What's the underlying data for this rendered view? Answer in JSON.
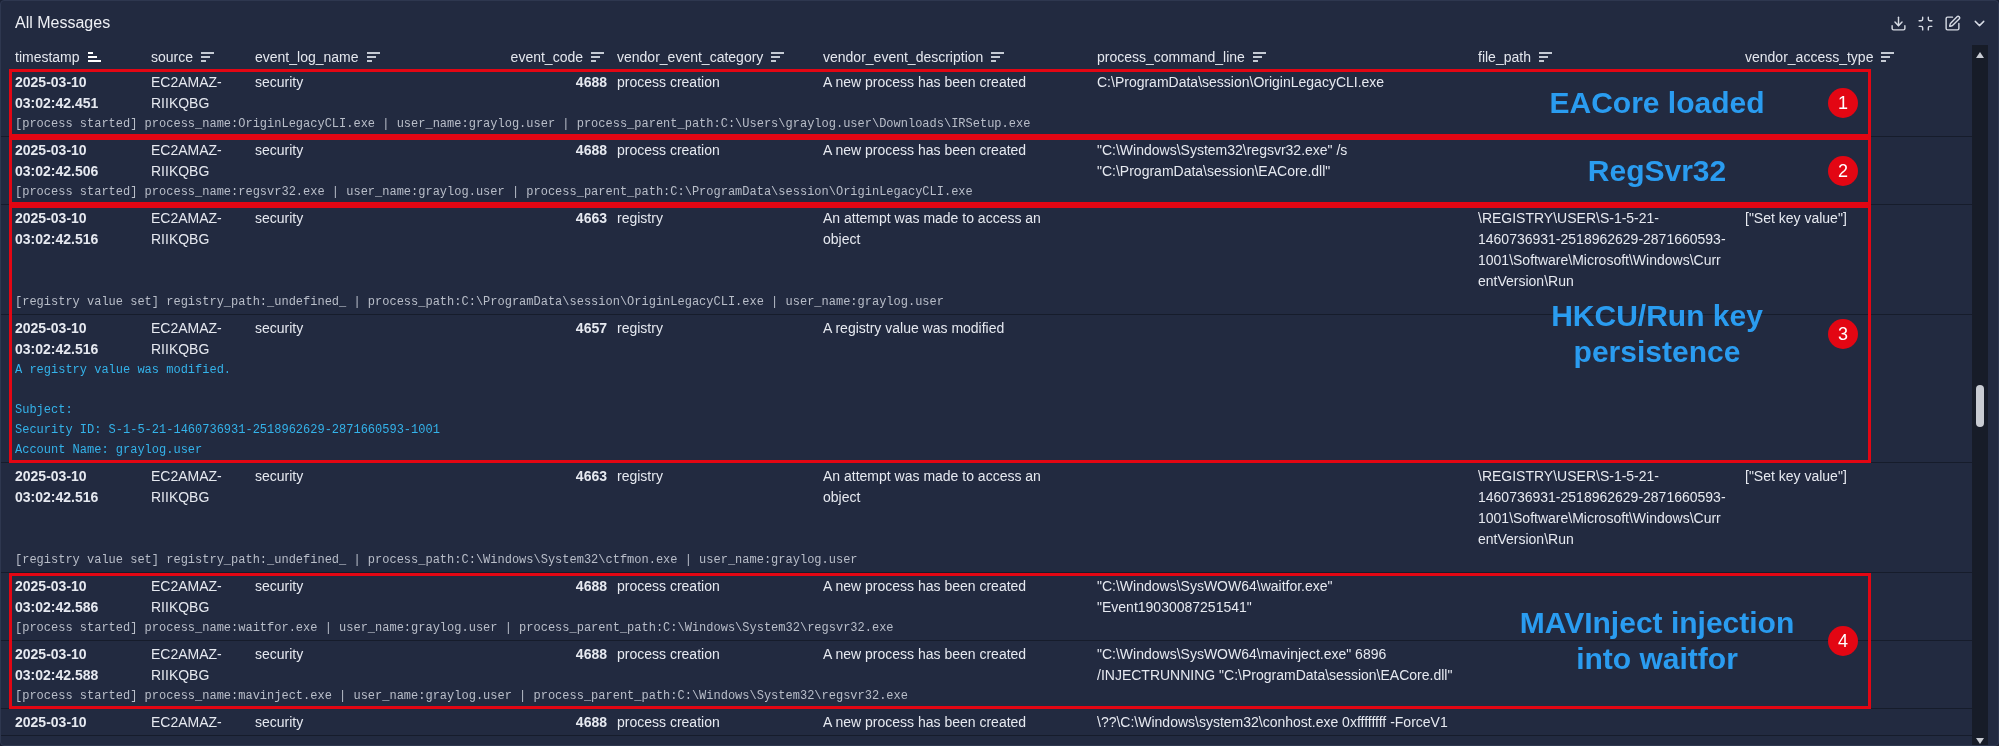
{
  "panel": {
    "title": "All Messages"
  },
  "columns": [
    {
      "label": "timestamp",
      "kind": "timestamp",
      "sorted": true
    },
    {
      "label": "source",
      "kind": "text",
      "sorted": false
    },
    {
      "label": "event_log_name",
      "kind": "text",
      "sorted": false
    },
    {
      "label": "event_code",
      "kind": "number",
      "sorted": false
    },
    {
      "label": "vendor_event_category",
      "kind": "text",
      "sorted": false
    },
    {
      "label": "vendor_event_description",
      "kind": "text",
      "sorted": false
    },
    {
      "label": "process_command_line",
      "kind": "command",
      "sorted": false
    },
    {
      "label": "file_path",
      "kind": "path",
      "sorted": false
    },
    {
      "label": "vendor_access_type",
      "kind": "text",
      "sorted": false
    }
  ],
  "groups": [
    {
      "kind": "annotated",
      "number": "1",
      "label": "EACore loaded",
      "rows": [
        {
          "cells": [
            "2025-03-10 03:02:42.451",
            "EC2AMAZ-RIIKQBG",
            "security",
            "4688",
            "process creation",
            "A new process has been created",
            "C:\\ProgramData\\session\\OriginLegacyCLI.exe",
            null,
            null
          ],
          "message": {
            "kind": "plain",
            "paragraphs": [
              [
                "[process started] process_name:OriginLegacyCLI.exe | user_name:graylog.user | process_parent_path:C:\\Users\\graylog.user\\Downloads\\IRSetup.exe"
              ]
            ]
          }
        }
      ]
    },
    {
      "kind": "annotated",
      "number": "2",
      "label": "RegSvr32",
      "rows": [
        {
          "cells": [
            "2025-03-10 03:02:42.506",
            "EC2AMAZ-RIIKQBG",
            "security",
            "4688",
            "process creation",
            "A new process has been created",
            "\"C:\\Windows\\System32\\regsvr32.exe\" /s \"C:\\ProgramData\\session\\EACore.dll\"",
            null,
            null
          ],
          "message": {
            "kind": "plain",
            "paragraphs": [
              [
                "[process started] process_name:regsvr32.exe | user_name:graylog.user | process_parent_path:C:\\ProgramData\\session\\OriginLegacyCLI.exe"
              ]
            ]
          }
        }
      ]
    },
    {
      "kind": "annotated",
      "number": "3",
      "label": "HKCU/Run key persistence",
      "rows": [
        {
          "cells": [
            "2025-03-10 03:02:42.516",
            "EC2AMAZ-RIIKQBG",
            "security",
            "4663",
            "registry",
            "An attempt was made to access an object",
            null,
            "\\REGISTRY\\USER\\S-1-5-21-1460736931-2518962629-2871660593-1001\\Software\\Microsoft\\Windows\\CurrentVersion\\Run",
            "[\"Set key value\"]"
          ],
          "message": {
            "kind": "plain",
            "paragraphs": [
              [
                "[registry value set] registry_path:_undefined_ | process_path:C:\\ProgramData\\session\\OriginLegacyCLI.exe | user_name:graylog.user"
              ]
            ]
          }
        },
        {
          "cells": [
            "2025-03-10 03:02:42.516",
            "EC2AMAZ-RIIKQBG",
            "security",
            "4657",
            "registry",
            "A registry value was modified",
            null,
            null,
            null
          ],
          "message": {
            "kind": "event",
            "paragraphs": [
              [
                "A registry value was modified."
              ],
              [
                "Subject:",
                "Security ID: S-1-5-21-1460736931-2518962629-2871660593-1001",
                "Account Name: graylog.user"
              ]
            ]
          }
        }
      ]
    },
    {
      "kind": "plain",
      "rows": [
        {
          "cells": [
            "2025-03-10 03:02:42.516",
            "EC2AMAZ-RIIKQBG",
            "security",
            "4663",
            "registry",
            "An attempt was made to access an object",
            null,
            "\\REGISTRY\\USER\\S-1-5-21-1460736931-2518962629-2871660593-1001\\Software\\Microsoft\\Windows\\CurrentVersion\\Run",
            "[\"Set key value\"]"
          ],
          "message": {
            "kind": "plain",
            "paragraphs": [
              [
                "[registry value set] registry_path:_undefined_ | process_path:C:\\Windows\\System32\\ctfmon.exe | user_name:graylog.user"
              ]
            ]
          }
        }
      ]
    },
    {
      "kind": "annotated",
      "number": "4",
      "label": "MAVInject injection into waitfor",
      "rows": [
        {
          "cells": [
            "2025-03-10 03:02:42.586",
            "EC2AMAZ-RIIKQBG",
            "security",
            "4688",
            "process creation",
            "A new process has been created",
            "\"C:\\Windows\\SysWOW64\\waitfor.exe\" \"Event19030087251541\"",
            null,
            null
          ],
          "message": {
            "kind": "plain",
            "paragraphs": [
              [
                "[process started] process_name:waitfor.exe | user_name:graylog.user | process_parent_path:C:\\Windows\\System32\\regsvr32.exe"
              ]
            ]
          }
        },
        {
          "cells": [
            "2025-03-10 03:02:42.588",
            "EC2AMAZ-RIIKQBG",
            "security",
            "4688",
            "process creation",
            "A new process has been created",
            "\"C:\\Windows\\SysWOW64\\mavinject.exe\" 6896 /INJECTRUNNING \"C:\\ProgramData\\session\\EACore.dll\"",
            null,
            null
          ],
          "message": {
            "kind": "plain",
            "paragraphs": [
              [
                "[process started] process_name:mavinject.exe | user_name:graylog.user | process_parent_path:C:\\Windows\\System32\\regsvr32.exe"
              ]
            ]
          }
        }
      ]
    },
    {
      "kind": "plain",
      "rows": [
        {
          "cells": [
            "2025-03-10",
            "EC2AMAZ-",
            "security",
            "4688",
            "process creation",
            "A new process has been created",
            "\\??\\C:\\Windows\\system32\\conhost.exe 0xffffffff -ForceV1",
            null,
            null
          ]
        }
      ]
    }
  ]
}
